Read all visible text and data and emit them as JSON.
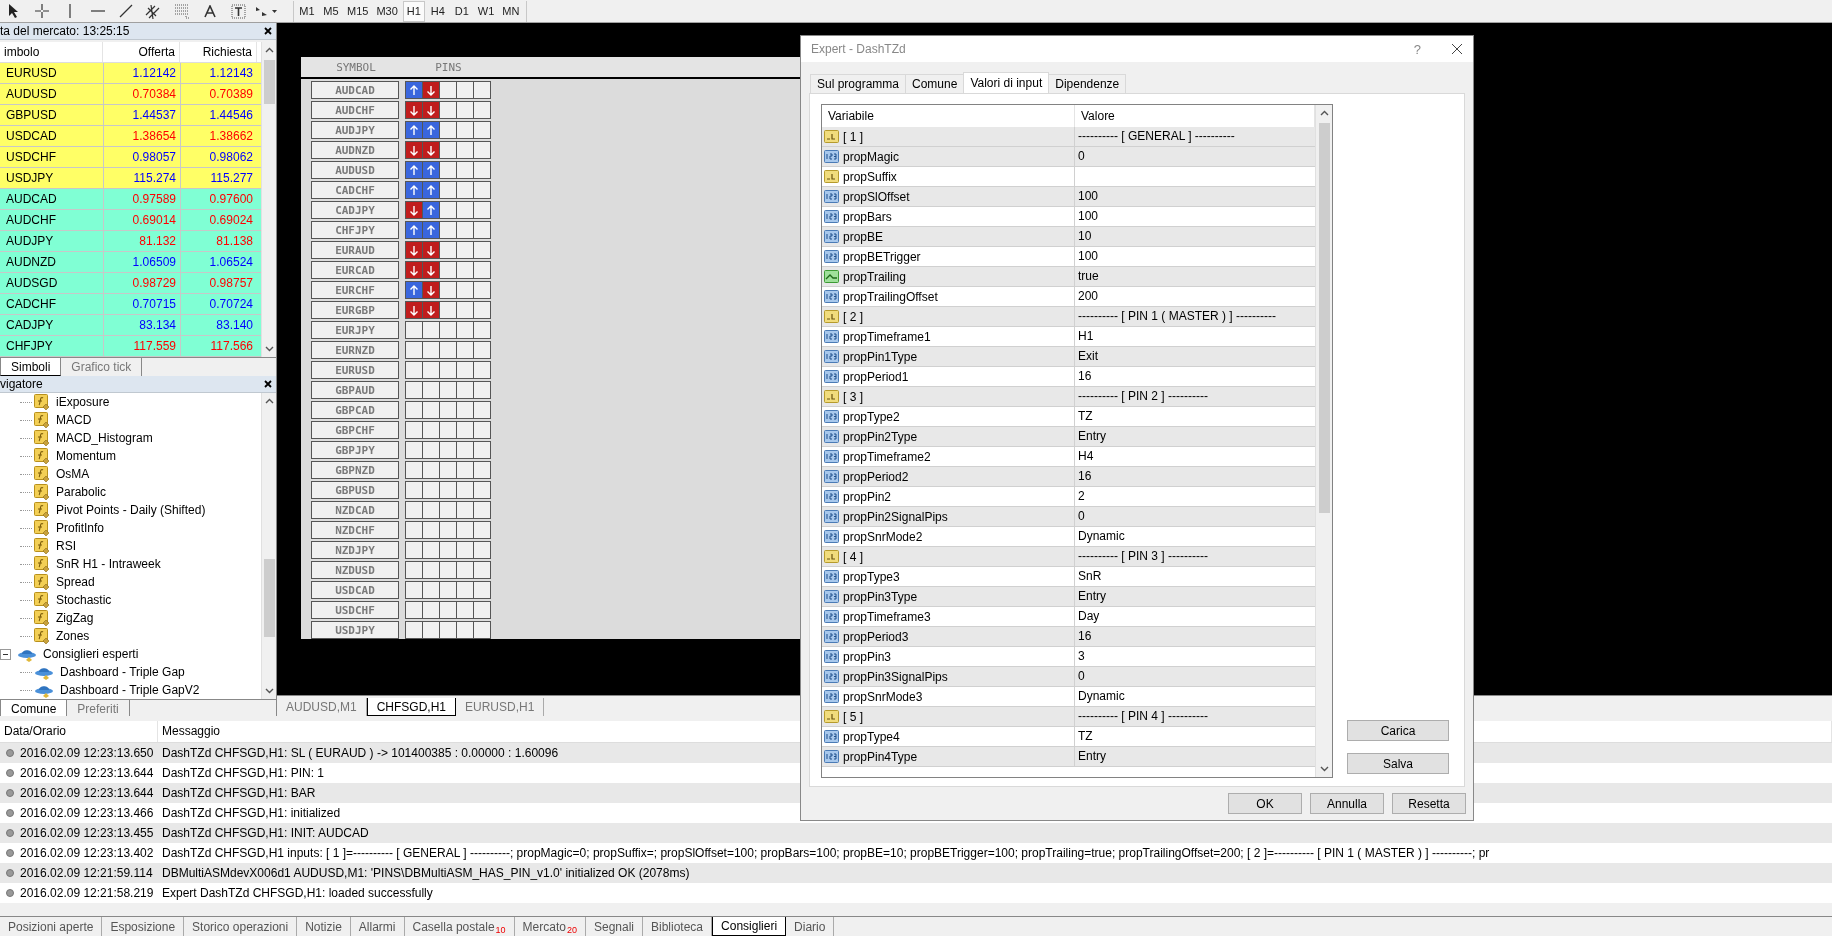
{
  "toolbar": {
    "tools": [
      {
        "kind": "cursor"
      },
      {
        "kind": "crosshair"
      },
      {
        "kind": "vline"
      },
      {
        "kind": "hline"
      },
      {
        "kind": "trendline"
      },
      {
        "kind": "channel"
      },
      {
        "kind": "fibo"
      },
      {
        "kind": "text"
      },
      {
        "kind": "label"
      },
      {
        "kind": "arrows"
      }
    ],
    "timeframes": [
      {
        "label": "M1",
        "selected": false
      },
      {
        "label": "M5",
        "selected": false
      },
      {
        "label": "M15",
        "selected": false
      },
      {
        "label": "M30",
        "selected": false
      },
      {
        "label": "H1",
        "selected": true
      },
      {
        "label": "H4",
        "selected": false
      },
      {
        "label": "D1",
        "selected": false
      },
      {
        "label": "W1",
        "selected": false
      },
      {
        "label": "MN",
        "selected": false
      }
    ]
  },
  "market_watch": {
    "title": "ta del mercato: 13:25:15",
    "columns": [
      "imbolo",
      "Offerta",
      "Richiesta"
    ],
    "rows": [
      {
        "symbol": "EURUSD",
        "bid": "1.12142",
        "ask": "1.12143",
        "color": "#ffff66",
        "rising": true
      },
      {
        "symbol": "AUDUSD",
        "bid": "0.70384",
        "ask": "0.70389",
        "color": "#ffff66",
        "rising": false
      },
      {
        "symbol": "GBPUSD",
        "bid": "1.44537",
        "ask": "1.44546",
        "color": "#ffff66",
        "rising": true
      },
      {
        "symbol": "USDCAD",
        "bid": "1.38654",
        "ask": "1.38662",
        "color": "#ffff66",
        "rising": false
      },
      {
        "symbol": "USDCHF",
        "bid": "0.98057",
        "ask": "0.98062",
        "color": "#ffff66",
        "rising": true
      },
      {
        "symbol": "USDJPY",
        "bid": "115.274",
        "ask": "115.277",
        "color": "#ffff66",
        "rising": true
      },
      {
        "symbol": "AUDCAD",
        "bid": "0.97589",
        "ask": "0.97600",
        "color": "#80ffd4",
        "rising": false
      },
      {
        "symbol": "AUDCHF",
        "bid": "0.69014",
        "ask": "0.69024",
        "color": "#80ffd4",
        "rising": false
      },
      {
        "symbol": "AUDJPY",
        "bid": "81.132",
        "ask": "81.138",
        "color": "#80ffd4",
        "rising": false
      },
      {
        "symbol": "AUDNZD",
        "bid": "1.06509",
        "ask": "1.06524",
        "color": "#80ffd4",
        "rising": true
      },
      {
        "symbol": "AUDSGD",
        "bid": "0.98729",
        "ask": "0.98757",
        "color": "#80ffd4",
        "rising": false
      },
      {
        "symbol": "CADCHF",
        "bid": "0.70715",
        "ask": "0.70724",
        "color": "#80ffd4",
        "rising": true
      },
      {
        "symbol": "CADJPY",
        "bid": "83.134",
        "ask": "83.140",
        "color": "#80ffd4",
        "rising": true
      },
      {
        "symbol": "CHFJPY",
        "bid": "117.559",
        "ask": "117.566",
        "color": "#80ffd4",
        "rising": false
      }
    ],
    "tabs": [
      {
        "label": "Simboli",
        "selected": true
      },
      {
        "label": "Grafico tick",
        "selected": false
      }
    ]
  },
  "navigator": {
    "title": "vigatore",
    "indicators": [
      "iExposure",
      "MACD",
      "MACD_Histogram",
      "Momentum",
      "OsMA",
      "Parabolic",
      "Pivot Points - Daily (Shifted)",
      "ProfitInfo",
      "RSI",
      "SnR H1 - Intraweek",
      "Spread",
      "Stochastic",
      "ZigZag",
      "Zones"
    ],
    "experts": {
      "label": "Consiglieri esperti",
      "expanded": true,
      "children": [
        {
          "label": "Dashboard - Triple Gap"
        },
        {
          "label": "Dashboard - Triple GapV2"
        }
      ]
    },
    "tabs": [
      {
        "label": "Comune",
        "selected": true
      },
      {
        "label": "Preferiti",
        "selected": false
      }
    ]
  },
  "dashboard": {
    "columns": [
      "SYMBOL",
      "PINS"
    ],
    "rows": [
      {
        "symbol": "AUDCAD",
        "pins": [
          {
            "kind": "up"
          },
          {
            "kind": "down"
          },
          {
            "kind": "empty"
          },
          {
            "kind": "empty"
          },
          {
            "kind": "empty"
          }
        ]
      },
      {
        "symbol": "AUDCHF",
        "pins": [
          {
            "kind": "down"
          },
          {
            "kind": "down"
          },
          {
            "kind": "empty"
          },
          {
            "kind": "empty"
          },
          {
            "kind": "empty"
          }
        ]
      },
      {
        "symbol": "AUDJPY",
        "pins": [
          {
            "kind": "up"
          },
          {
            "kind": "up"
          },
          {
            "kind": "empty"
          },
          {
            "kind": "empty"
          },
          {
            "kind": "empty"
          }
        ]
      },
      {
        "symbol": "AUDNZD",
        "pins": [
          {
            "kind": "down"
          },
          {
            "kind": "down"
          },
          {
            "kind": "empty"
          },
          {
            "kind": "empty"
          },
          {
            "kind": "empty"
          }
        ]
      },
      {
        "symbol": "AUDUSD",
        "pins": [
          {
            "kind": "up"
          },
          {
            "kind": "up"
          },
          {
            "kind": "empty"
          },
          {
            "kind": "empty"
          },
          {
            "kind": "empty"
          }
        ]
      },
      {
        "symbol": "CADCHF",
        "pins": [
          {
            "kind": "up"
          },
          {
            "kind": "up"
          },
          {
            "kind": "empty"
          },
          {
            "kind": "empty"
          },
          {
            "kind": "empty"
          }
        ]
      },
      {
        "symbol": "CADJPY",
        "pins": [
          {
            "kind": "down"
          },
          {
            "kind": "up"
          },
          {
            "kind": "empty"
          },
          {
            "kind": "empty"
          },
          {
            "kind": "empty"
          }
        ]
      },
      {
        "symbol": "CHFJPY",
        "pins": [
          {
            "kind": "up"
          },
          {
            "kind": "up"
          },
          {
            "kind": "empty"
          },
          {
            "kind": "empty"
          },
          {
            "kind": "empty"
          }
        ]
      },
      {
        "symbol": "EURAUD",
        "pins": [
          {
            "kind": "down"
          },
          {
            "kind": "down"
          },
          {
            "kind": "empty"
          },
          {
            "kind": "empty"
          },
          {
            "kind": "empty"
          }
        ]
      },
      {
        "symbol": "EURCAD",
        "pins": [
          {
            "kind": "down"
          },
          {
            "kind": "down"
          },
          {
            "kind": "empty"
          },
          {
            "kind": "empty"
          },
          {
            "kind": "empty"
          }
        ]
      },
      {
        "symbol": "EURCHF",
        "pins": [
          {
            "kind": "up"
          },
          {
            "kind": "down"
          },
          {
            "kind": "empty"
          },
          {
            "kind": "empty"
          },
          {
            "kind": "empty"
          }
        ]
      },
      {
        "symbol": "EURGBP",
        "pins": [
          {
            "kind": "down"
          },
          {
            "kind": "down"
          },
          {
            "kind": "empty"
          },
          {
            "kind": "empty"
          },
          {
            "kind": "empty"
          }
        ]
      },
      {
        "symbol": "EURJPY",
        "pins": [
          {
            "kind": "empty"
          },
          {
            "kind": "empty"
          },
          {
            "kind": "empty"
          },
          {
            "kind": "empty"
          },
          {
            "kind": "empty"
          }
        ]
      },
      {
        "symbol": "EURNZD",
        "pins": [
          {
            "kind": "empty"
          },
          {
            "kind": "empty"
          },
          {
            "kind": "empty"
          },
          {
            "kind": "empty"
          },
          {
            "kind": "empty"
          }
        ]
      },
      {
        "symbol": "EURUSD",
        "pins": [
          {
            "kind": "empty"
          },
          {
            "kind": "empty"
          },
          {
            "kind": "empty"
          },
          {
            "kind": "empty"
          },
          {
            "kind": "empty"
          }
        ]
      },
      {
        "symbol": "GBPAUD",
        "pins": [
          {
            "kind": "empty"
          },
          {
            "kind": "empty"
          },
          {
            "kind": "empty"
          },
          {
            "kind": "empty"
          },
          {
            "kind": "empty"
          }
        ]
      },
      {
        "symbol": "GBPCAD",
        "pins": [
          {
            "kind": "empty"
          },
          {
            "kind": "empty"
          },
          {
            "kind": "empty"
          },
          {
            "kind": "empty"
          },
          {
            "kind": "empty"
          }
        ]
      },
      {
        "symbol": "GBPCHF",
        "pins": [
          {
            "kind": "empty"
          },
          {
            "kind": "empty"
          },
          {
            "kind": "empty"
          },
          {
            "kind": "empty"
          },
          {
            "kind": "empty"
          }
        ]
      },
      {
        "symbol": "GBPJPY",
        "pins": [
          {
            "kind": "empty"
          },
          {
            "kind": "empty"
          },
          {
            "kind": "empty"
          },
          {
            "kind": "empty"
          },
          {
            "kind": "empty"
          }
        ]
      },
      {
        "symbol": "GBPNZD",
        "pins": [
          {
            "kind": "empty"
          },
          {
            "kind": "empty"
          },
          {
            "kind": "empty"
          },
          {
            "kind": "empty"
          },
          {
            "kind": "empty"
          }
        ]
      },
      {
        "symbol": "GBPUSD",
        "pins": [
          {
            "kind": "empty"
          },
          {
            "kind": "empty"
          },
          {
            "kind": "empty"
          },
          {
            "kind": "empty"
          },
          {
            "kind": "empty"
          }
        ]
      },
      {
        "symbol": "NZDCAD",
        "pins": [
          {
            "kind": "empty"
          },
          {
            "kind": "empty"
          },
          {
            "kind": "empty"
          },
          {
            "kind": "empty"
          },
          {
            "kind": "empty"
          }
        ]
      },
      {
        "symbol": "NZDCHF",
        "pins": [
          {
            "kind": "empty"
          },
          {
            "kind": "empty"
          },
          {
            "kind": "empty"
          },
          {
            "kind": "empty"
          },
          {
            "kind": "empty"
          }
        ]
      },
      {
        "symbol": "NZDJPY",
        "pins": [
          {
            "kind": "empty"
          },
          {
            "kind": "empty"
          },
          {
            "kind": "empty"
          },
          {
            "kind": "empty"
          },
          {
            "kind": "empty"
          }
        ]
      },
      {
        "symbol": "NZDUSD",
        "pins": [
          {
            "kind": "empty"
          },
          {
            "kind": "empty"
          },
          {
            "kind": "empty"
          },
          {
            "kind": "empty"
          },
          {
            "kind": "empty"
          }
        ]
      },
      {
        "symbol": "USDCAD",
        "pins": [
          {
            "kind": "empty"
          },
          {
            "kind": "empty"
          },
          {
            "kind": "empty"
          },
          {
            "kind": "empty"
          },
          {
            "kind": "empty"
          }
        ]
      },
      {
        "symbol": "USDCHF",
        "pins": [
          {
            "kind": "empty"
          },
          {
            "kind": "empty"
          },
          {
            "kind": "empty"
          },
          {
            "kind": "empty"
          },
          {
            "kind": "empty"
          }
        ]
      },
      {
        "symbol": "USDJPY",
        "pins": [
          {
            "kind": "empty"
          },
          {
            "kind": "empty"
          },
          {
            "kind": "empty"
          },
          {
            "kind": "empty"
          },
          {
            "kind": "empty"
          }
        ]
      }
    ]
  },
  "chart_tabs": [
    {
      "label": "AUDUSD,M1",
      "selected": false
    },
    {
      "label": "CHFSGD,H1",
      "selected": true
    },
    {
      "label": "EURUSD,H1",
      "selected": false
    }
  ],
  "dialog": {
    "title": "Expert - DashTZd",
    "help": "?",
    "tabs": [
      {
        "label": "Sul programma",
        "selected": false
      },
      {
        "label": "Comune",
        "selected": false
      },
      {
        "label": "Valori di input",
        "selected": true
      },
      {
        "label": "Dipendenze",
        "selected": false
      }
    ],
    "columns": [
      "Variabile",
      "Valore"
    ],
    "rows": [
      {
        "kind": "string",
        "name": "[ 1 ]",
        "value": "---------- [ GENERAL ] ----------"
      },
      {
        "kind": "number",
        "name": "propMagic",
        "value": "0"
      },
      {
        "kind": "string",
        "name": "propSuffix"
      },
      {
        "kind": "number",
        "name": "propSlOffset",
        "value": "100"
      },
      {
        "kind": "number",
        "name": "propBars",
        "value": "100"
      },
      {
        "kind": "number",
        "name": "propBE",
        "value": "10"
      },
      {
        "kind": "number",
        "name": "propBETrigger",
        "value": "100"
      },
      {
        "kind": "bool",
        "name": "propTrailing",
        "value": "true"
      },
      {
        "kind": "number",
        "name": "propTrailingOffset",
        "value": "200"
      },
      {
        "kind": "string",
        "name": "[ 2 ]",
        "value": "---------- [ PIN 1 ( MASTER ) ] ----------"
      },
      {
        "kind": "number",
        "name": "propTimeframe1",
        "value": "H1"
      },
      {
        "kind": "number",
        "name": "propPin1Type",
        "value": "Exit"
      },
      {
        "kind": "number",
        "name": "propPeriod1",
        "value": "16"
      },
      {
        "kind": "string",
        "name": "[ 3 ]",
        "value": "---------- [ PIN 2 ] ----------"
      },
      {
        "kind": "number",
        "name": "propType2",
        "value": "TZ"
      },
      {
        "kind": "number",
        "name": "propPin2Type",
        "value": "Entry"
      },
      {
        "kind": "number",
        "name": "propTimeframe2",
        "value": "H4"
      },
      {
        "kind": "number",
        "name": "propPeriod2",
        "value": "16"
      },
      {
        "kind": "number",
        "name": "propPin2",
        "value": "2"
      },
      {
        "kind": "number",
        "name": "propPin2SignalPips",
        "value": "0"
      },
      {
        "kind": "number",
        "name": "propSnrMode2",
        "value": "Dynamic"
      },
      {
        "kind": "string",
        "name": "[ 4 ]",
        "value": "---------- [ PIN 3 ] ----------"
      },
      {
        "kind": "number",
        "name": "propType3",
        "value": "SnR"
      },
      {
        "kind": "number",
        "name": "propPin3Type",
        "value": "Entry"
      },
      {
        "kind": "number",
        "name": "propTimeframe3",
        "value": "Day"
      },
      {
        "kind": "number",
        "name": "propPeriod3",
        "value": "16"
      },
      {
        "kind": "number",
        "name": "propPin3",
        "value": "3"
      },
      {
        "kind": "number",
        "name": "propPin3SignalPips",
        "value": "0"
      },
      {
        "kind": "number",
        "name": "propSnrMode3",
        "value": "Dynamic"
      },
      {
        "kind": "string",
        "name": "[ 5 ]",
        "value": "---------- [ PIN 4 ] ----------"
      },
      {
        "kind": "number",
        "name": "propType4",
        "value": "TZ"
      },
      {
        "kind": "number",
        "name": "propPin4Type",
        "value": "Entry"
      }
    ],
    "side_buttons": [
      "Carica",
      "Salva"
    ],
    "buttons": [
      "OK",
      "Annulla",
      "Resetta"
    ]
  },
  "log": {
    "columns": [
      "Data/Orario",
      "Messaggio"
    ],
    "rows": [
      {
        "time": "2016.02.09 12:23:13.650",
        "message": "DashTZd CHFSGD,H1: SL ( EURAUD ) -> 101400385 : 0.00000 : 1.60096"
      },
      {
        "time": "2016.02.09 12:23:13.644",
        "message": "DashTZd CHFSGD,H1: PIN: 1"
      },
      {
        "time": "2016.02.09 12:23:13.644",
        "message": "DashTZd CHFSGD,H1: BAR"
      },
      {
        "time": "2016.02.09 12:23:13.466",
        "message": "DashTZd CHFSGD,H1: initialized"
      },
      {
        "time": "2016.02.09 12:23:13.455",
        "message": "DashTZd CHFSGD,H1: INIT: AUDCAD"
      },
      {
        "time": "2016.02.09 12:23:13.402",
        "message": "DashTZd CHFSGD,H1 inputs: [ 1 ]=---------- [ GENERAL ] ----------; propMagic=0; propSuffix=; propSlOffset=100; propBars=100; propBE=10; propBETrigger=100; propTrailing=true; propTrailingOffset=200; [ 2 ]=---------- [ PIN 1 ( MASTER ) ] ----------; pr"
      },
      {
        "time": "2016.02.09 12:21:59.114",
        "message": "DBMultiASMdevX006d1 AUDUSD,M1: 'PINS\\DBMultiASM_HAS_PIN_v1.0' initialized OK (2078ms)"
      },
      {
        "time": "2016.02.09 12:21:58.219",
        "message": "Expert DashTZd CHFSGD,H1: loaded successfully"
      }
    ]
  },
  "bottom_tabs": [
    {
      "label": "Posizioni aperte",
      "selected": false
    },
    {
      "label": "Esposizione",
      "selected": false
    },
    {
      "label": "Storico operazioni",
      "selected": false
    },
    {
      "label": "Notizie",
      "selected": false
    },
    {
      "label": "Allarmi",
      "selected": false
    },
    {
      "label": "Casella postale",
      "badge": "10",
      "selected": false
    },
    {
      "label": "Mercato",
      "badge": "20",
      "selected": false
    },
    {
      "label": "Segnali",
      "selected": false
    },
    {
      "label": "Biblioteca",
      "selected": false
    },
    {
      "label": "Consiglieri",
      "selected": true
    },
    {
      "label": "Diario",
      "selected": false
    }
  ]
}
